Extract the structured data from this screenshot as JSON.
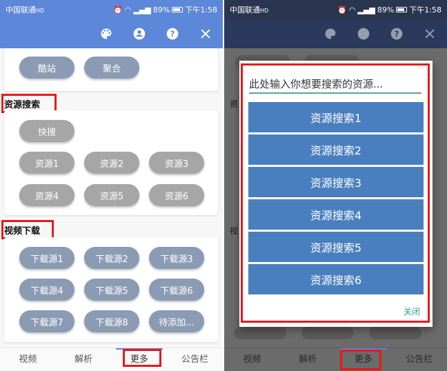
{
  "status": {
    "carrier": "中国联通",
    "carrier_extra": "HD",
    "battery": "89%",
    "time": "下午1:58"
  },
  "appbar": {
    "icons": [
      "palette-icon",
      "account-icon",
      "help-icon",
      "close-icon"
    ],
    "color": "#5d87d8"
  },
  "top_buttons": [
    "酷站",
    "聚合"
  ],
  "resource_search": {
    "title": "资源搜索",
    "quick": "快搜",
    "buttons": [
      "资源1",
      "资源2",
      "资源3",
      "资源4",
      "资源5",
      "资源6"
    ]
  },
  "video_download": {
    "title": "视频下载",
    "buttons": [
      "下载源1",
      "下载源2",
      "下载源3",
      "下载源4",
      "下载源5",
      "下载源6",
      "下载源7",
      "下载源8",
      "待添加..."
    ]
  },
  "bottom_nav": [
    "视频",
    "解析",
    "更多",
    "公告栏"
  ],
  "dialog": {
    "placeholder": "此处输入你想要搜索的资源...",
    "options": [
      "资源搜索1",
      "资源搜索2",
      "资源搜索3",
      "资源搜索4",
      "资源搜索5",
      "资源搜索6"
    ],
    "close": "关闭"
  },
  "right_bg_labels": [
    "资",
    "视"
  ],
  "colors": {
    "accent": "#5d87d8",
    "pill_blue": "#8b9bb4",
    "pill_grey": "#a6a6a6",
    "dialog_button": "#4a7fbf",
    "highlight_red": "#e51a1a",
    "close_text": "#2a9d8f"
  }
}
